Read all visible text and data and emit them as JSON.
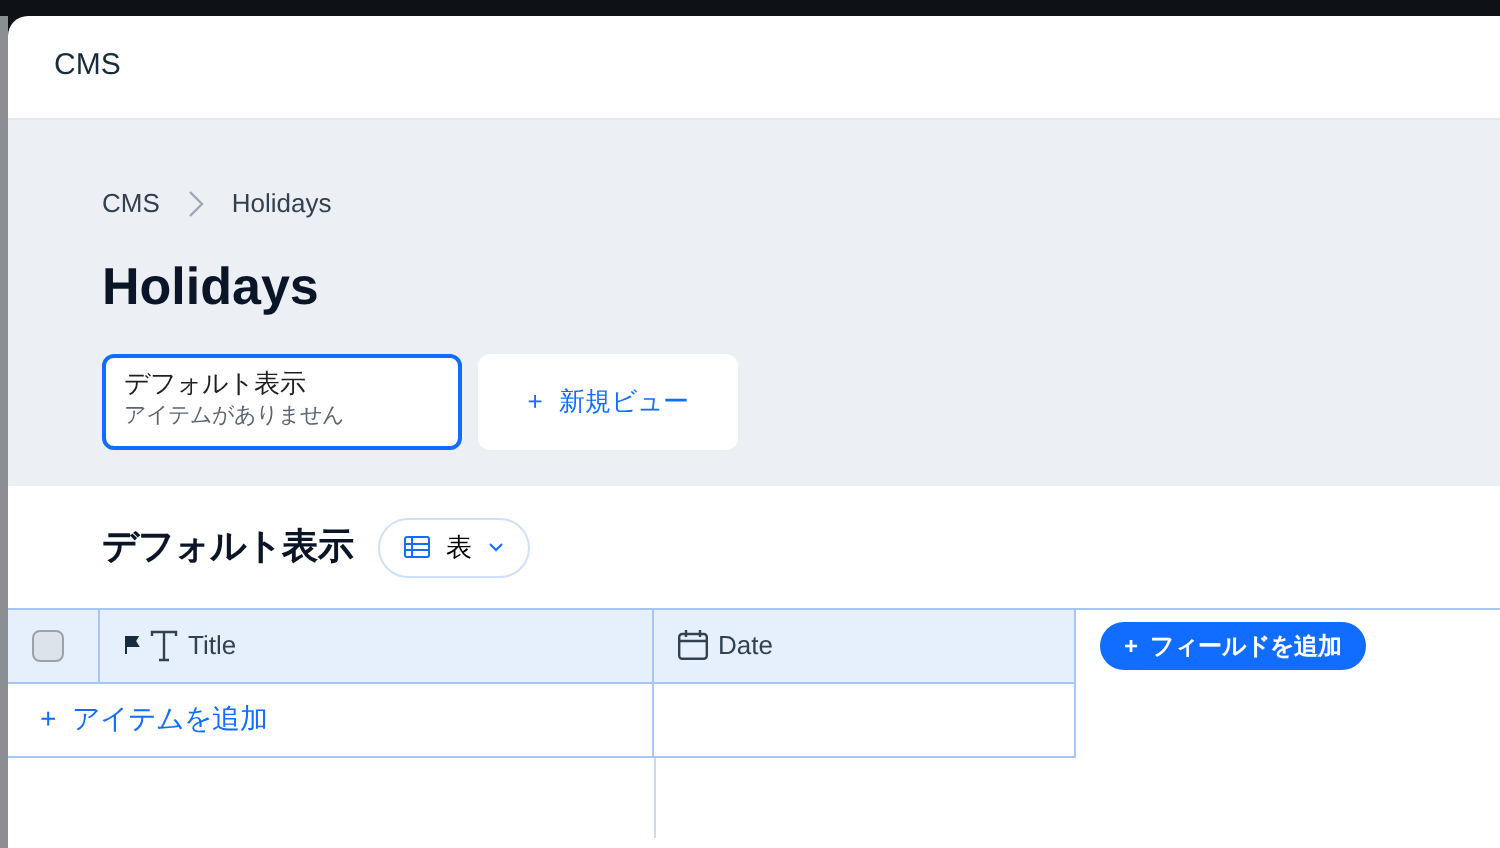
{
  "panel": {
    "title": "CMS"
  },
  "breadcrumb": [
    {
      "label": "CMS"
    },
    {
      "label": "Holidays"
    }
  ],
  "page_title": "Holidays",
  "views": [
    {
      "kind": "view",
      "name": "デフォルト表示",
      "subtitle": "アイテムがありません",
      "selected": true
    },
    {
      "kind": "new",
      "name": "新規ビュー",
      "icon": "+",
      "selected": false
    }
  ],
  "view_header": {
    "title": "デフォルト表示",
    "layout_button": "表"
  },
  "table": {
    "select_all_checked": false,
    "columns": [
      {
        "kind": "text",
        "label": "Title",
        "primary": true
      },
      {
        "kind": "date",
        "label": "Date",
        "primary": false
      }
    ],
    "add_field_button": "フィールドを追加",
    "add_item": "アイテムを追加"
  }
}
